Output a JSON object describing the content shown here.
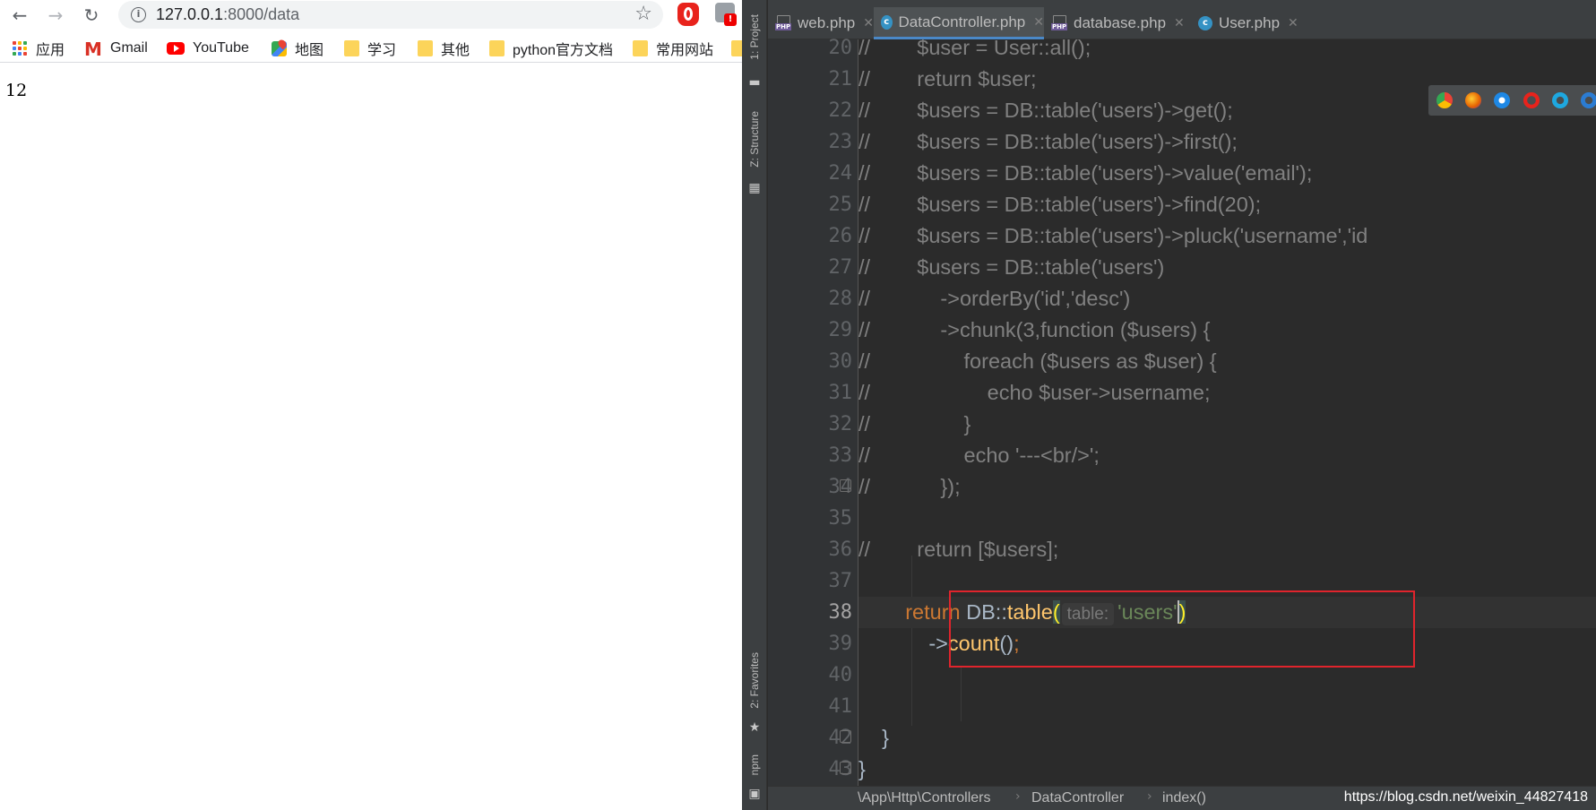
{
  "browser": {
    "url_host": "127.0.0.1",
    "url_path": ":8000/data",
    "page_output": "12",
    "bookmarks": [
      {
        "label": "应用",
        "icon": "apps-icon"
      },
      {
        "label": "Gmail",
        "icon": "gmail-icon"
      },
      {
        "label": "YouTube",
        "icon": "youtube-icon"
      },
      {
        "label": "地图",
        "icon": "maps-icon"
      },
      {
        "label": "学习",
        "icon": "folder-icon"
      },
      {
        "label": "其他",
        "icon": "folder-icon"
      },
      {
        "label": "python官方文档",
        "icon": "folder-icon"
      },
      {
        "label": "常用网站",
        "icon": "folder-icon"
      }
    ],
    "extension_badge": "!"
  },
  "ide": {
    "sidebar_tools": {
      "project": "1: Project",
      "structure": "Z: Structure",
      "favorites": "2: Favorites",
      "npm": "npm"
    },
    "tabs": [
      {
        "label": "web.php",
        "icon": "php-file-icon",
        "active": false
      },
      {
        "label": "DataController.php",
        "icon": "class-icon",
        "active": true
      },
      {
        "label": "database.php",
        "icon": "php-file-icon",
        "active": false
      },
      {
        "label": "User.php",
        "icon": "class-icon",
        "active": false
      }
    ],
    "line_numbers": [
      "20",
      "21",
      "22",
      "23",
      "24",
      "25",
      "26",
      "27",
      "28",
      "29",
      "30",
      "31",
      "32",
      "33",
      "34",
      "35",
      "36",
      "37",
      "38",
      "39",
      "40",
      "41",
      "42",
      "43"
    ],
    "code": {
      "l20": "//        $user = User::all();",
      "l21": "//        return $user;",
      "l22": "//        $users = DB::table('users')->get();",
      "l23": "//        $users = DB::table('users')->first();",
      "l24": "//        $users = DB::table('users')->value('email');",
      "l25": "//        $users = DB::table('users')->find(20);",
      "l26": "//        $users = DB::table('users')->pluck('username','id",
      "l27": "//        $users = DB::table('users')",
      "l28": "//            ->orderBy('id','desc')",
      "l29": "//            ->chunk(3,function ($users) {",
      "l30": "//                foreach ($users as $user) {",
      "l31": "//                    echo $user->username;",
      "l32": "//                }",
      "l33": "//                echo '---<br/>';",
      "l34": "//            });",
      "l36": "//        return [$users];",
      "l38_indent": "        ",
      "l38_kw": "return",
      "l38_class": " DB::",
      "l38_fn": "table",
      "l38_open": "(",
      "l38_hint": "table:",
      "l38_str": "'users'",
      "l38_close": ")",
      "l39_indent": "            ->",
      "l39_fn": "count",
      "l39_rest": "()",
      "l39_semi": ";",
      "l42": "    }",
      "l43": "}"
    },
    "breadcrumbs": [
      "\\App\\Http\\Controllers",
      "DataController",
      "index()"
    ],
    "watermark": "https://blog.csdn.net/weixin_44827418",
    "accent_color": "#4a88c7",
    "highlight_color": "#e0242c"
  }
}
